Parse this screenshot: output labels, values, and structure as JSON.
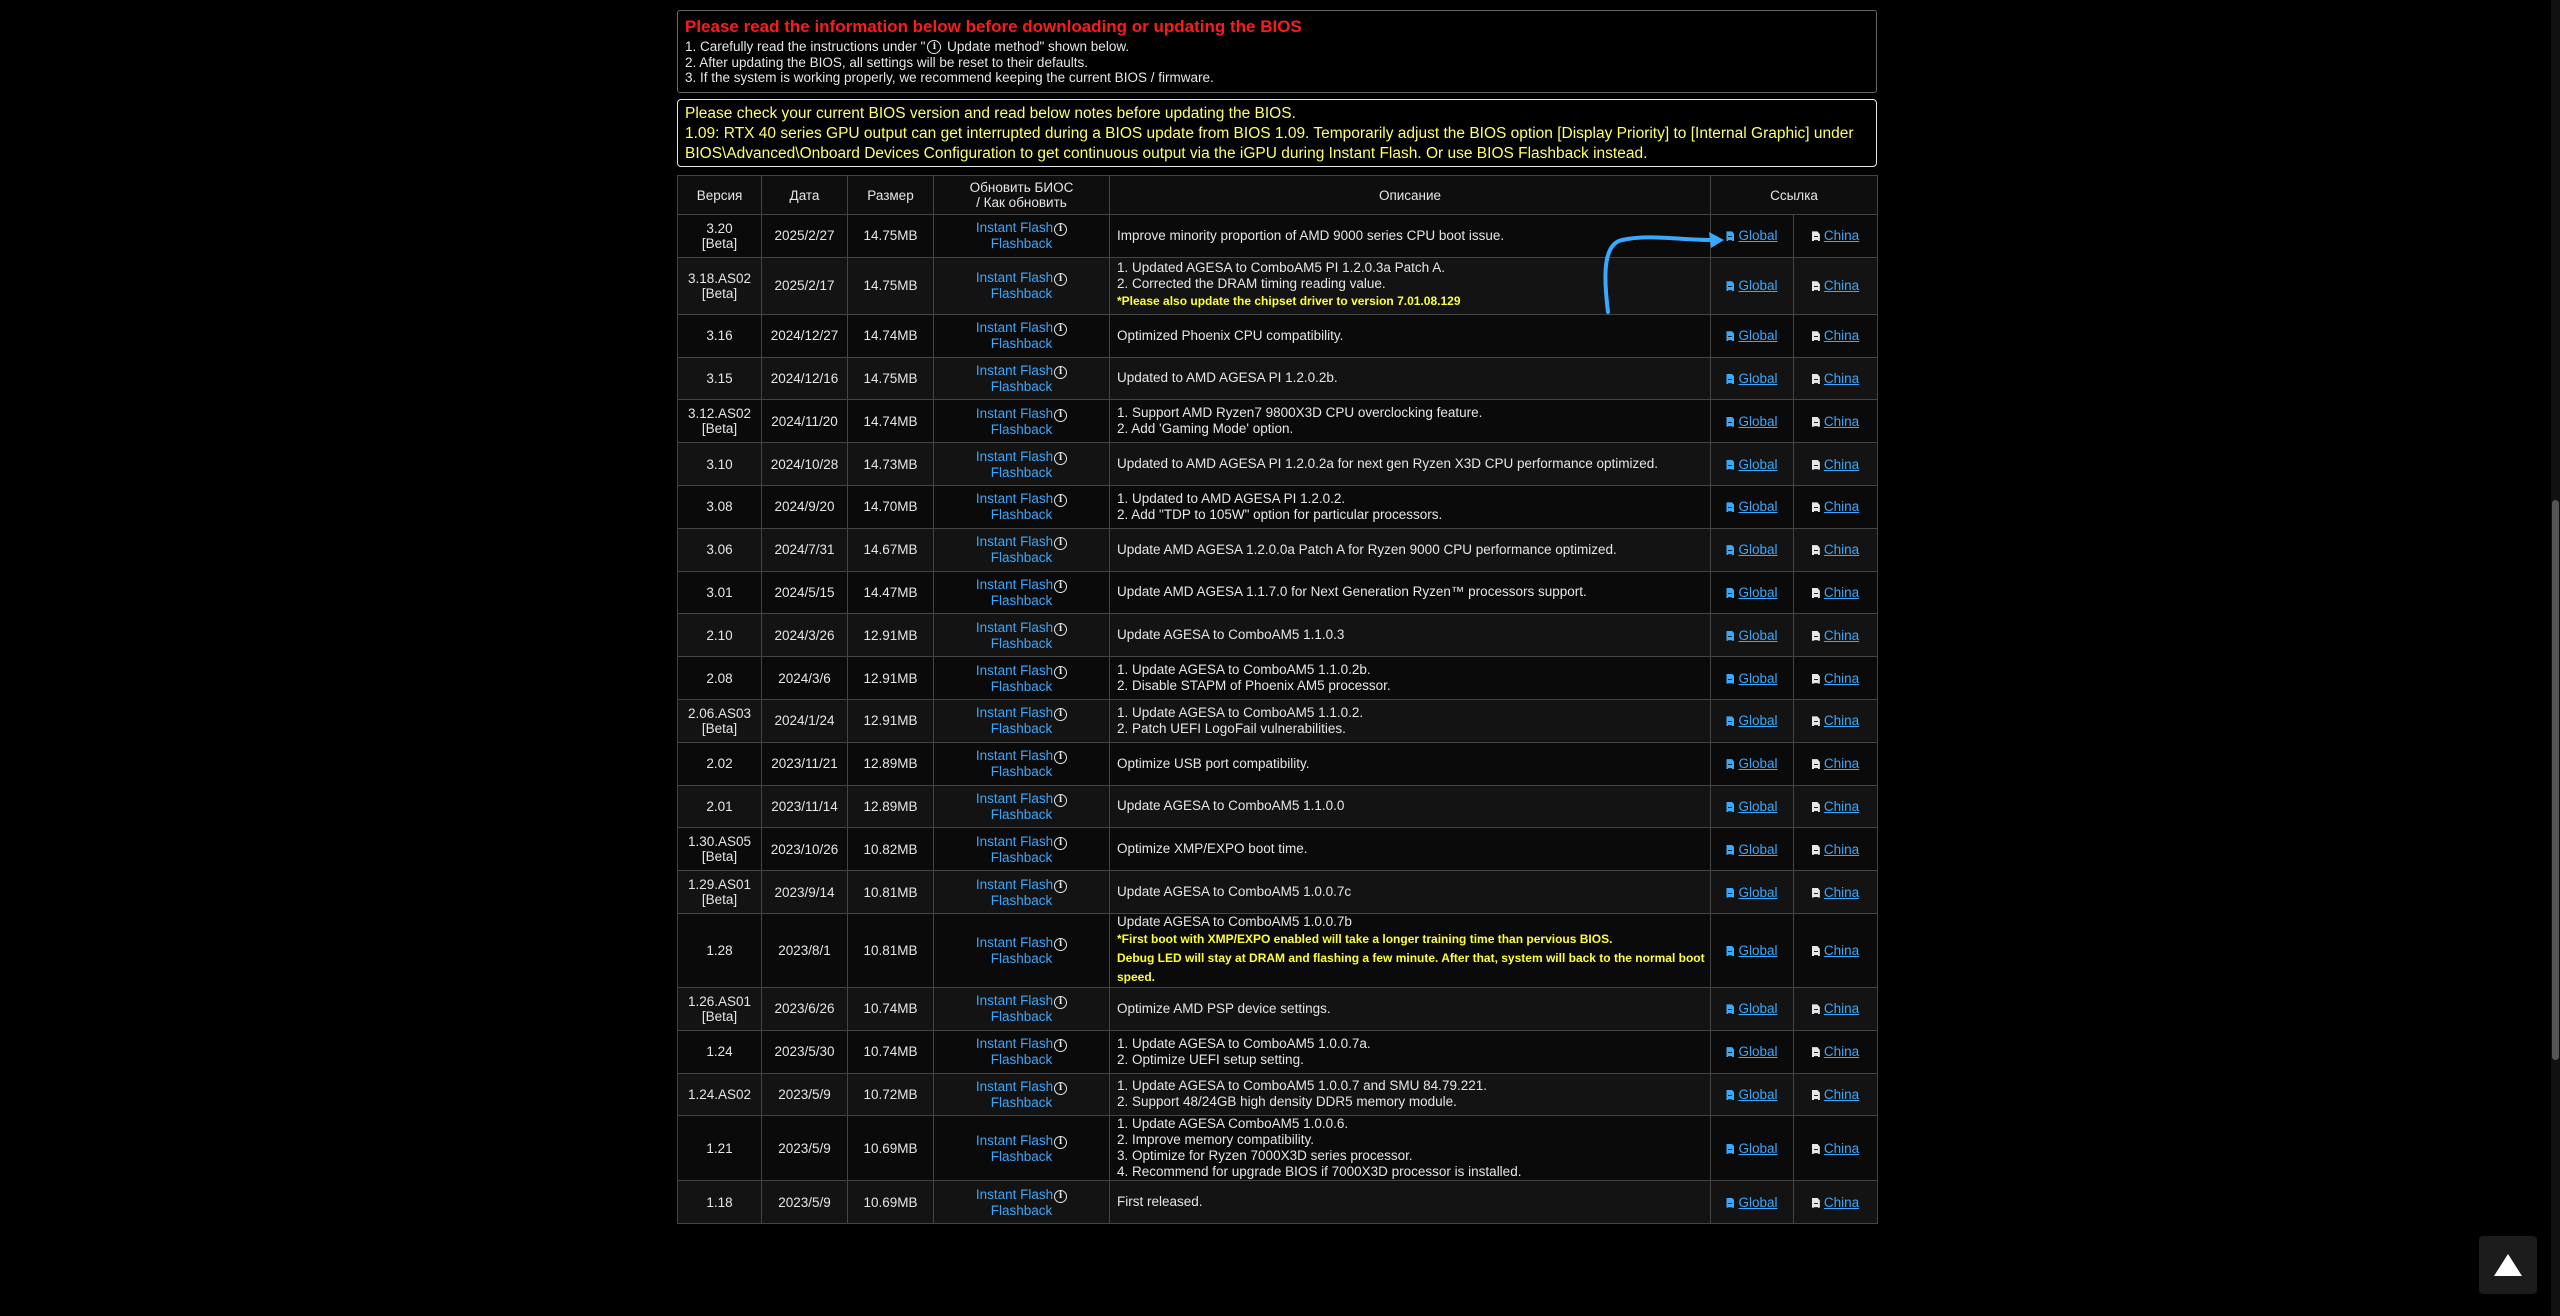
{
  "notice": {
    "heading": "Please read the information below before downloading or updating the BIOS",
    "line1_pre": "1. Carefully read the instructions under \"",
    "line1_post": " Update method\" shown below.",
    "line2": "2. After updating the BIOS, all settings will be reset to their defaults.",
    "line3": "3. If the system is working properly, we recommend keeping the current BIOS / firmware."
  },
  "notice2": {
    "line1": "Please check your current BIOS version and read below notes before updating the BIOS.",
    "line2": "1.09: RTX 40 series GPU output can get interrupted during a BIOS update from BIOS 1.09. Temporarily adjust the BIOS option [Display Priority] to [Internal Graphic] under BIOS\\Advanced\\Onboard Devices Configuration to get continuous output via the iGPU during Instant Flash. Or use BIOS Flashback instead."
  },
  "table": {
    "headers": {
      "version": "Версия",
      "date": "Дата",
      "size": "Размер",
      "update1": "Обновить БИОС",
      "update2": "/ Как обновить",
      "desc": "Описание",
      "link": "Ссылка"
    },
    "instant_flash": "Instant Flash",
    "flashback": "Flashback",
    "global": "Global",
    "china": "China",
    "rows": [
      {
        "v1": "3.20",
        "v2": "[Beta]",
        "date": "2025/2/27",
        "size": "14.75MB",
        "lines": [
          "Improve minority proportion of AMD 9000 series CPU boot issue."
        ]
      },
      {
        "v1": "3.18.AS02",
        "v2": "[Beta]",
        "date": "2025/2/17",
        "size": "14.75MB",
        "lines": [
          "1. Updated AGESA to ComboAM5 PI 1.2.0.3a Patch A.",
          "2. Corrected the DRAM timing reading value."
        ],
        "notes": [
          "*Please also update the chipset driver to version 7.01.08.129"
        ]
      },
      {
        "v1": "3.16",
        "date": "2024/12/27",
        "size": "14.74MB",
        "lines": [
          "Optimized Phoenix CPU compatibility."
        ]
      },
      {
        "v1": "3.15",
        "date": "2024/12/16",
        "size": "14.75MB",
        "lines": [
          "Updated to AMD AGESA PI 1.2.0.2b."
        ]
      },
      {
        "v1": "3.12.AS02",
        "v2": "[Beta]",
        "date": "2024/11/20",
        "size": "14.74MB",
        "lines": [
          "1. Support AMD Ryzen7 9800X3D CPU overclocking feature.",
          "2. Add 'Gaming Mode' option."
        ]
      },
      {
        "v1": "3.10",
        "date": "2024/10/28",
        "size": "14.73MB",
        "lines": [
          "Updated to AMD AGESA PI 1.2.0.2a for next gen Ryzen X3D CPU performance optimized."
        ]
      },
      {
        "v1": "3.08",
        "date": "2024/9/20",
        "size": "14.70MB",
        "lines": [
          "1. Updated to AMD AGESA PI 1.2.0.2.",
          "2. Add \"TDP to 105W\" option for particular processors."
        ]
      },
      {
        "v1": "3.06",
        "date": "2024/7/31",
        "size": "14.67MB",
        "lines": [
          "Update AMD AGESA 1.2.0.0a Patch A for Ryzen 9000 CPU performance optimized."
        ]
      },
      {
        "v1": "3.01",
        "date": "2024/5/15",
        "size": "14.47MB",
        "lines": [
          "Update AMD AGESA 1.1.7.0 for Next Generation Ryzen™ processors support."
        ]
      },
      {
        "v1": "2.10",
        "date": "2024/3/26",
        "size": "12.91MB",
        "lines": [
          "Update AGESA to ComboAM5 1.1.0.3"
        ]
      },
      {
        "v1": "2.08",
        "date": "2024/3/6",
        "size": "12.91MB",
        "lines": [
          "1. Update AGESA to ComboAM5 1.1.0.2b.",
          "2. Disable STAPM of Phoenix AM5 processor."
        ]
      },
      {
        "v1": "2.06.AS03",
        "v2": "[Beta]",
        "date": "2024/1/24",
        "size": "12.91MB",
        "lines": [
          "1. Update AGESA to ComboAM5 1.1.0.2.",
          "2. Patch UEFI LogoFail vulnerabilities."
        ]
      },
      {
        "v1": "2.02",
        "date": "2023/11/21",
        "size": "12.89MB",
        "lines": [
          "Optimize USB port compatibility."
        ]
      },
      {
        "v1": "2.01",
        "date": "2023/11/14",
        "size": "12.89MB",
        "lines": [
          "Update AGESA to ComboAM5 1.1.0.0"
        ]
      },
      {
        "v1": "1.30.AS05",
        "v2": "[Beta]",
        "date": "2023/10/26",
        "size": "10.82MB",
        "lines": [
          "Optimize XMP/EXPO boot time."
        ]
      },
      {
        "v1": "1.29.AS01",
        "v2": "[Beta]",
        "date": "2023/9/14",
        "size": "10.81MB",
        "lines": [
          "Update AGESA to ComboAM5 1.0.0.7c"
        ]
      },
      {
        "v1": "1.28",
        "date": "2023/8/1",
        "size": "10.81MB",
        "lines": [
          "Update AGESA to ComboAM5 1.0.0.7b"
        ],
        "notes": [
          "*First boot with XMP/EXPO enabled will take a longer training time than pervious BIOS.",
          "Debug LED will stay at DRAM and flashing a few minute. After that, system will back to the normal boot speed."
        ]
      },
      {
        "v1": "1.26.AS01",
        "v2": "[Beta]",
        "date": "2023/6/26",
        "size": "10.74MB",
        "lines": [
          "Optimize AMD PSP device settings."
        ]
      },
      {
        "v1": "1.24",
        "date": "2023/5/30",
        "size": "10.74MB",
        "lines": [
          "1. Update AGESA to ComboAM5 1.0.0.7a.",
          "2. Optimize UEFI setup setting."
        ]
      },
      {
        "v1": "1.24.AS02",
        "date": "2023/5/9",
        "size": "10.72MB",
        "lines": [
          "1. Update AGESA to ComboAM5 1.0.0.7 and SMU 84.79.221.",
          "2. Support 48/24GB high density DDR5 memory module."
        ]
      },
      {
        "v1": "1.21",
        "date": "2023/5/9",
        "size": "10.69MB",
        "lines": [
          "1. Update AGESA ComboAM5 1.0.0.6.",
          "2. Improve memory compatibility.",
          "3. Optimize for Ryzen 7000X3D series processor.",
          "4. Recommend for upgrade BIOS if 7000X3D processor is installed."
        ]
      },
      {
        "v1": "1.18",
        "date": "2023/5/9",
        "size": "10.69MB",
        "lines": [
          "First released."
        ]
      }
    ]
  },
  "colors": {
    "accent_link": "#39a8ff",
    "warning_red": "#ff1a1a",
    "note_yellow": "#ffff33",
    "arrow": "#39a8ff"
  }
}
